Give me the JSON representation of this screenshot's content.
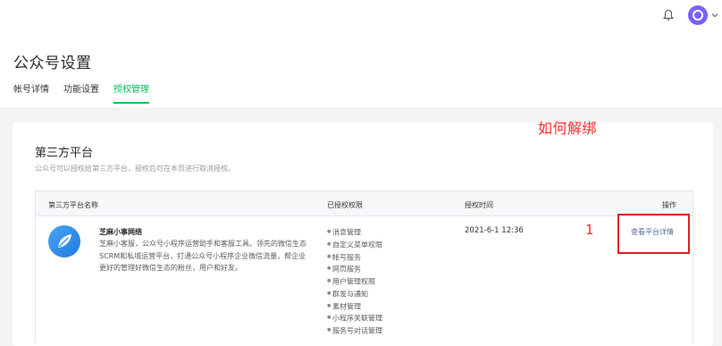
{
  "topbar": {
    "bell_icon": "bell-icon",
    "avatar_icon": "avatar-icon",
    "caret_icon": "chevron-down-icon"
  },
  "header": {
    "title": "公众号设置",
    "tabs": [
      {
        "label": "帐号详情",
        "active": false
      },
      {
        "label": "功能设置",
        "active": false
      },
      {
        "label": "授权管理",
        "active": true
      }
    ]
  },
  "annotations": {
    "title": "如何解绑",
    "step_number": "1"
  },
  "section": {
    "title": "第三方平台",
    "description": "公众号可以授权给第三方平台，授权后可在本页进行取消授权。"
  },
  "table": {
    "headers": [
      "第三方平台名称",
      "已授权权限",
      "授权时间",
      "操作"
    ],
    "rows": [
      {
        "name": "芝麻小事网络",
        "description": "芝麻小客服，公众号小程序运营助手和客服工具。领先的微信生态SCRM和私域运营平台，打通公众号小程序企业微信流量，帮企业更好的管理好微信生态的粉丝，用户和好友。",
        "permissions": [
          "消息管理",
          "自定义菜单权限",
          "帐号服务",
          "网页服务",
          "用户管理权限",
          "群发与通知",
          "素材管理",
          "小程序关联管理",
          "服务号对话管理"
        ],
        "auth_time": "2021-6-1 12:36",
        "action": "查看平台详情"
      }
    ]
  },
  "colors": {
    "accent": "#07c160",
    "link": "#576b95",
    "annotation": "#ff2a2a"
  }
}
